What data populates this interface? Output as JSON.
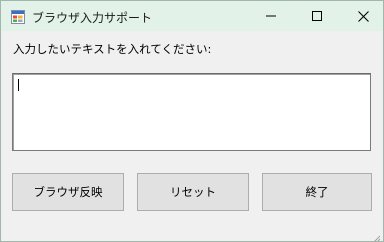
{
  "window": {
    "title": "ブラウザ入力サポート"
  },
  "form": {
    "prompt": "入力したいテキストを入れてください:",
    "text_value": ""
  },
  "buttons": {
    "browser_label": "ブラウザ反映",
    "reset_label": "リセット",
    "exit_label": "終了"
  },
  "colors": {
    "titlebar_bg": "#e3f2e8",
    "window_bg": "#f0f0f0",
    "button_bg": "#e1e1e1",
    "button_border": "#adadad"
  },
  "icons": {
    "app": "app-window-icon",
    "minimize": "minimize-icon",
    "maximize": "maximize-icon",
    "close": "close-icon",
    "resize_grip": "resize-grip-icon"
  }
}
